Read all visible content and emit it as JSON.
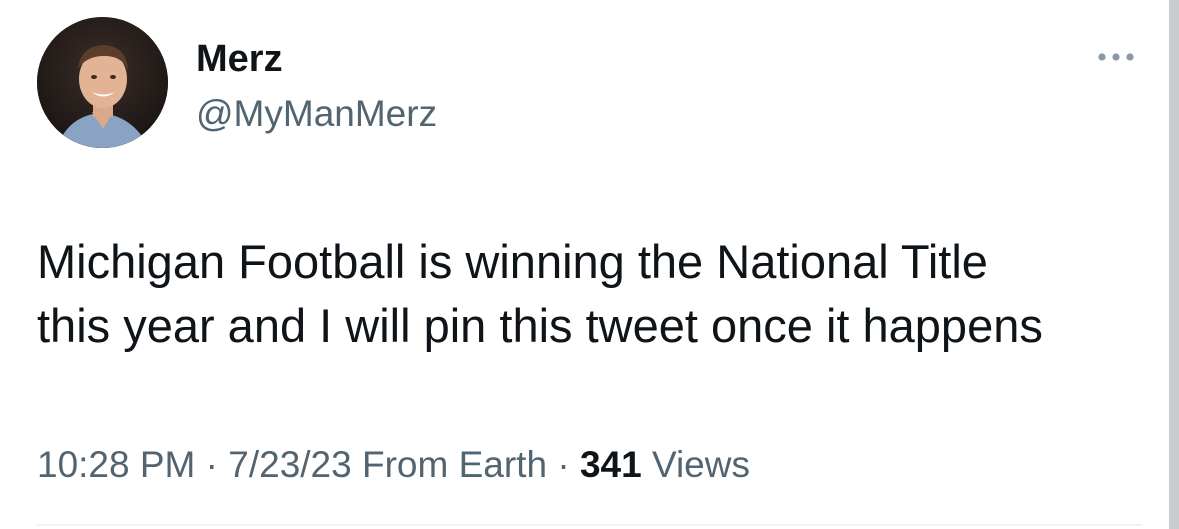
{
  "tweet": {
    "author": {
      "display_name": "Merz",
      "handle": "@MyManMerz",
      "avatar_icon": "profile-photo"
    },
    "more_icon": "more-options-icon",
    "text_lines": [
      "Michigan Football is winning the National Title",
      "this year and I will pin this tweet once it happens"
    ],
    "meta": {
      "time": "10:28 PM",
      "separator": "·",
      "date": "7/23/23",
      "source": "From Earth",
      "views_count": "341",
      "views_label": "Views"
    }
  },
  "colors": {
    "primary_text": "#0f1419",
    "secondary_text": "#536471",
    "divider": "#eff3f4"
  }
}
